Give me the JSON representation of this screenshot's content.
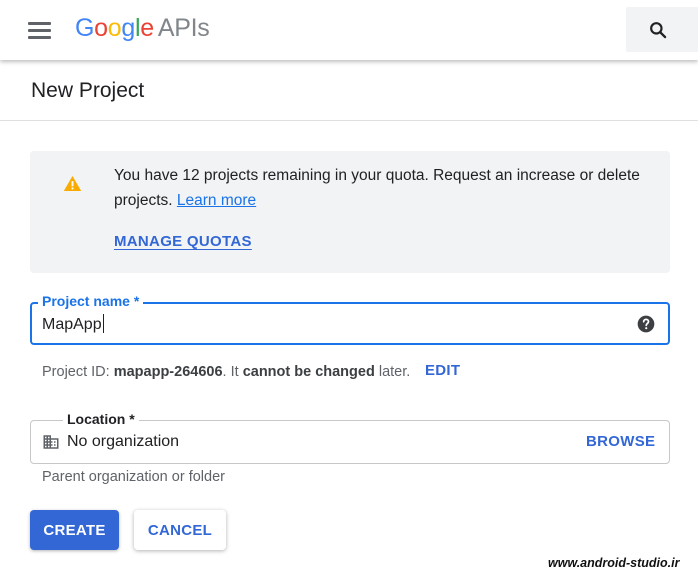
{
  "header": {
    "logo_google": "Google",
    "logo_apis": "APIs",
    "brand_colors": [
      "#4285f4",
      "#ea4335",
      "#fbbc05",
      "#4285f4",
      "#34a853",
      "#ea4335"
    ],
    "menu_icon": "hamburger-menu-icon",
    "search_icon": "search-icon"
  },
  "page": {
    "title": "New Project"
  },
  "warning": {
    "icon": "warning-icon",
    "text": "You have 12 projects remaining in your quota. Request an increase or delete projects.",
    "learn_more": "Learn more",
    "manage_quotas": "MANAGE QUOTAS"
  },
  "project_name": {
    "label": "Project name *",
    "value": "MapApp",
    "help_icon": "help-circle-icon"
  },
  "project_id": {
    "prefix": "Project ID:",
    "id": "mapapp-264606",
    "suffix_1": ". It",
    "bold_phrase": "cannot be changed",
    "suffix_2": "later.",
    "edit_label": "EDIT"
  },
  "location": {
    "label": "Location *",
    "value": "No organization",
    "icon": "building-icon",
    "browse_label": "BROWSE",
    "helper": "Parent organization or folder"
  },
  "actions": {
    "create_label": "CREATE",
    "cancel_label": "CANCEL"
  },
  "watermark": "www.android-studio.ir",
  "colors": {
    "accent": "#3367d6",
    "focus": "#1a73e8",
    "warning": "#f9ab00"
  }
}
